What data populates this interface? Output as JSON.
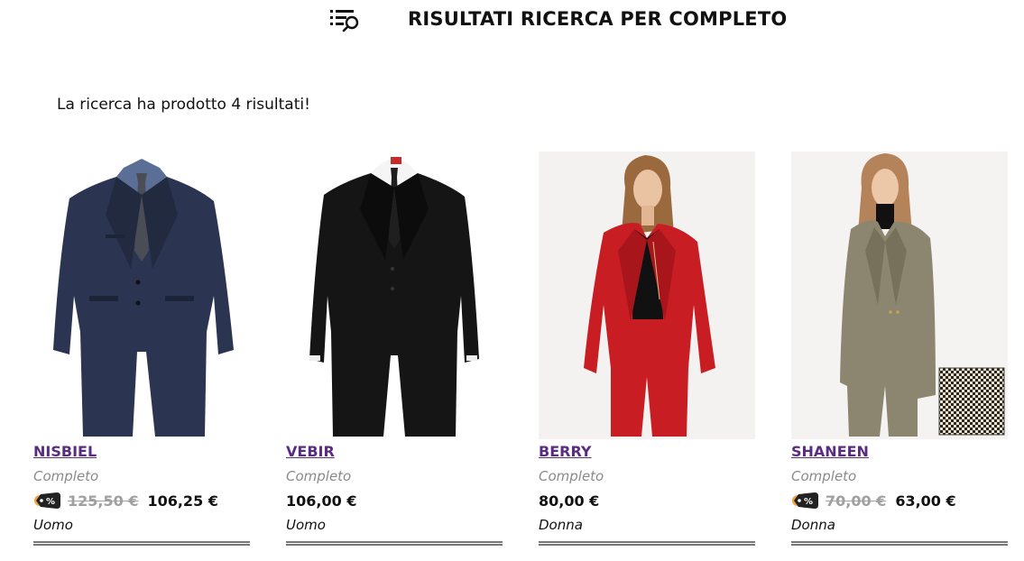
{
  "page": {
    "title": "RISULTATI RICERCA PER COMPLETO",
    "header_icon": "list-search-icon",
    "results_text": "La ricerca ha prodotto 4 risultati!"
  },
  "colors": {
    "product_link": "#5a2d82",
    "old_price": "#a0a0a0",
    "divider": "#777777"
  },
  "products": [
    {
      "name": "NISBIEL",
      "category": "Completo",
      "old_price": "125,50 €",
      "price": "106,25 €",
      "gender": "Uomo",
      "discount": true,
      "discount_icon": "discount-tag-icon"
    },
    {
      "name": "VEBIR",
      "category": "Completo",
      "old_price": "",
      "price": "106,00 €",
      "gender": "Uomo",
      "discount": false
    },
    {
      "name": "BERRY",
      "category": "Completo",
      "old_price": "",
      "price": "80,00 €",
      "gender": "Donna",
      "discount": false
    },
    {
      "name": "SHANEEN",
      "category": "Completo",
      "old_price": "70,00 €",
      "price": "63,00 €",
      "gender": "Donna",
      "discount": true,
      "discount_icon": "discount-tag-icon"
    }
  ]
}
